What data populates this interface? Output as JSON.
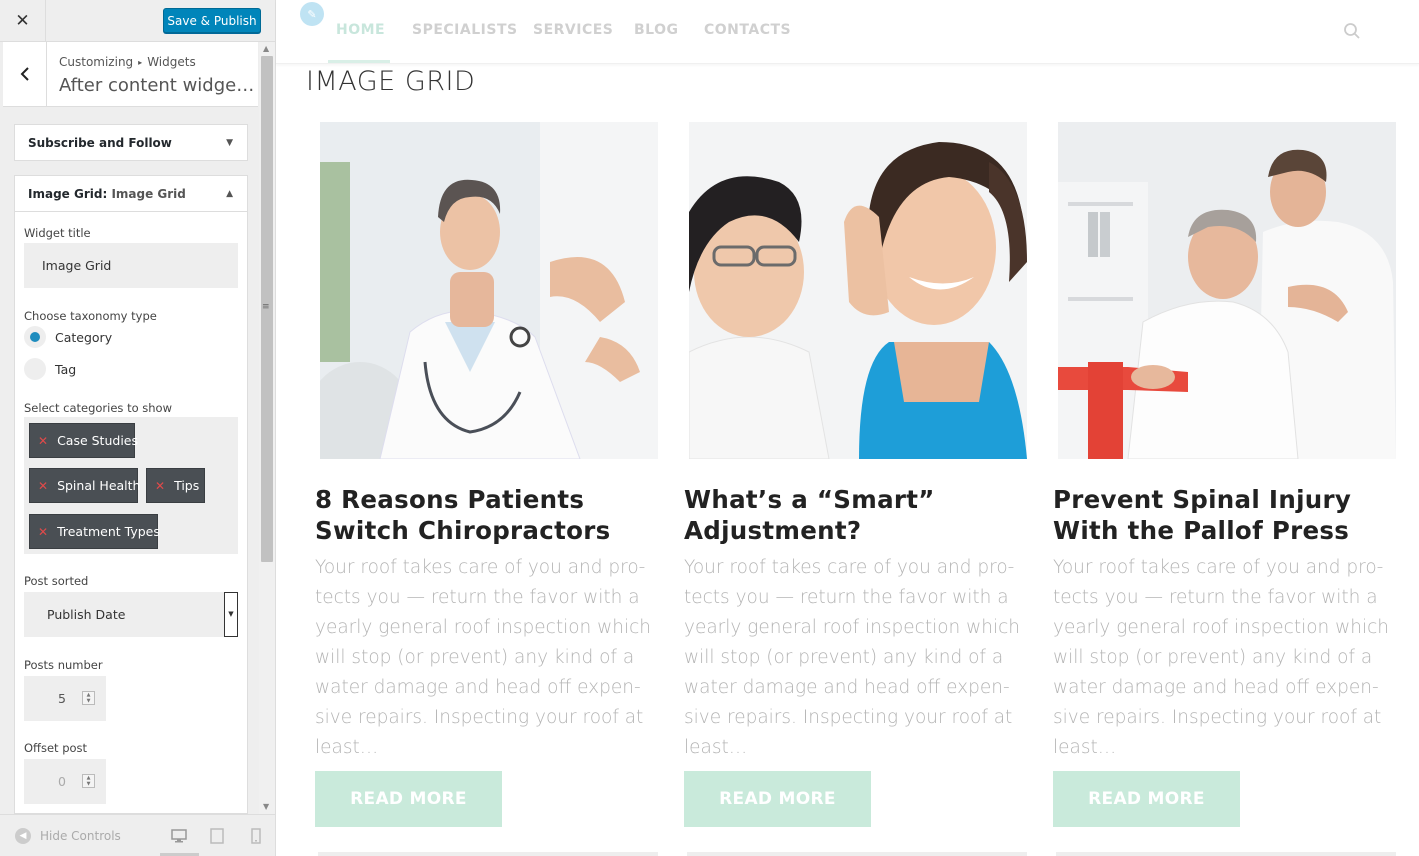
{
  "customizer": {
    "close_icon": "close-icon",
    "publish_label": "Save & Publish",
    "breadcrumb": {
      "root": "Customizing",
      "separator": "▸",
      "section": "Widgets"
    },
    "panel_title": "After content widget a...",
    "widgets": [
      {
        "title": "Subscribe and Follow",
        "expanded": false
      },
      {
        "title_prefix": "Image Grid:",
        "title_name": "Image Grid",
        "expanded": true
      }
    ],
    "form": {
      "widget_title_label": "Widget title",
      "widget_title_value": "Image Grid",
      "taxonomy_label": "Choose taxonomy type",
      "taxonomy_options": [
        {
          "label": "Category",
          "selected": true
        },
        {
          "label": "Tag",
          "selected": false
        }
      ],
      "categories_label": "Select categories to show",
      "categories": [
        "Case Studies",
        "Spinal Health",
        "Tips",
        "Treatment Types"
      ],
      "post_sorted_label": "Post sorted",
      "post_sorted_value": "Publish Date",
      "posts_number_label": "Posts number",
      "posts_number_value": "5",
      "offset_label": "Offset post",
      "offset_value": "0"
    },
    "footer": {
      "hide_controls": "Hide Controls",
      "devices": [
        "desktop",
        "tablet",
        "mobile"
      ]
    }
  },
  "site": {
    "nav": [
      "HOME",
      "SPECIALISTS",
      "SERVICES",
      "BLOG",
      "CONTACTS"
    ],
    "active_nav": "HOME",
    "section_title": "IMAGE GRID",
    "cards": [
      {
        "title": "8 Reasons Patients Switch Chiropractors",
        "excerpt": "Your roof takes care of you and pro­tects you — return the favor with a yearly general roof inspection which will stop (or prevent) any kind of a water damage and head off expen­sive repairs. Inspecting your roof at least…",
        "button": "READ MORE",
        "image": "doctor-explaining-photo"
      },
      {
        "title": "What’s a “Smart” Adjust­ment?",
        "excerpt": "Your roof takes care of you and pro­tects you — return the favor with a yearly general roof inspection which will stop (or prevent) any kind of a water damage and head off expen­sive repairs. Inspecting your roof at least…",
        "button": "READ MORE",
        "image": "chiropractor-neck-adjustment-photo"
      },
      {
        "title": "Prevent Spinal Injury With the Pallof Press",
        "excerpt": "Your roof takes care of you and pro­tects you — return the favor with a yearly general roof inspection which will stop (or prevent) any kind of a water damage and head off expen­sive repairs. Inspecting your roof at least…",
        "button": "READ MORE",
        "image": "physical-therapy-band-photo"
      }
    ]
  },
  "colors": {
    "accent": "#0085ba",
    "readmore": "#c9eadb",
    "nav_active": "#c8e6dc"
  }
}
